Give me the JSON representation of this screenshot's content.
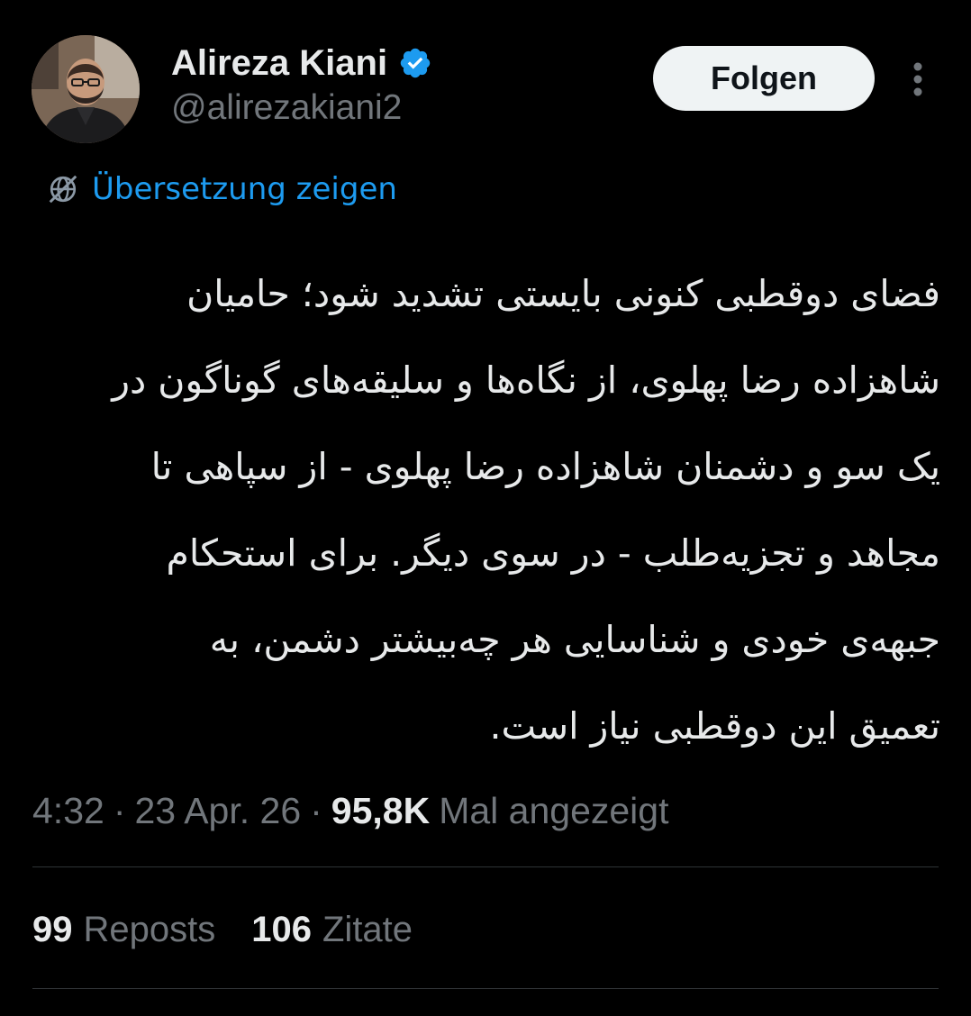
{
  "author": {
    "display_name": "Alireza Kiani",
    "handle": "@alirezakiani2",
    "verified_icon": "verified-badge-icon",
    "avatar_icon": "profile-photo"
  },
  "header": {
    "follow_label": "Folgen",
    "more_icon": "more-vertical-icon"
  },
  "translate": {
    "icon": "translate-globe-icon",
    "label": "Übersetzung zeigen"
  },
  "tweet": {
    "lines": [
      "فضای دوقطبی کنونی بایستی تشدید شود؛ حامیان",
      "شاهزاده رضا پهلوی، از نگاه‌ها و سلیقه‌های گوناگون در",
      "یک سو و دشمنان شاهزاده رضا پهلوی - از سپاهی تا",
      "مجاهد و تجزیه‌طلب - در سوی دیگر. برای استحکام",
      "جبهه‌ی خودی و شناسایی هر چه‌بیشتر دشمن، به",
      "تعمیق این دوقطبی نیاز است."
    ]
  },
  "meta": {
    "time": "4:32",
    "separator": "·",
    "date": "23 Apr. 26",
    "views_count": "95,8K",
    "views_label": "Mal angezeigt"
  },
  "stats": {
    "reposts_count": "99",
    "reposts_label": "Reposts",
    "quotes_count": "106",
    "quotes_label": "Zitate"
  },
  "colors": {
    "background": "#000000",
    "text_primary": "#e7e9ea",
    "text_secondary": "#71767b",
    "link": "#1d9bf0",
    "verified": "#1d9bf0",
    "divider": "#2f3336",
    "button_bg": "#eff3f4"
  }
}
